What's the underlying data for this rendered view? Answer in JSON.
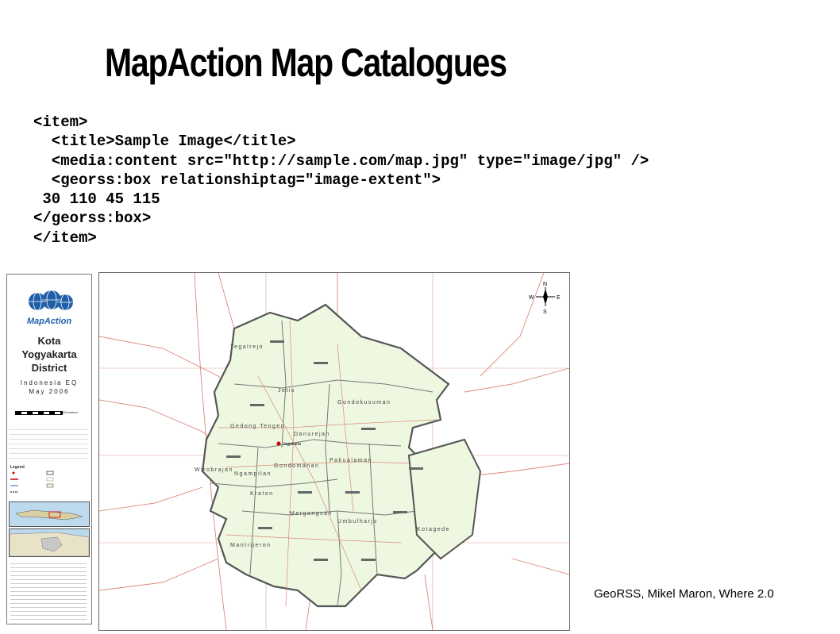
{
  "slide": {
    "title": "MapAction Map Catalogues",
    "code_lines": [
      "<item>",
      "  <title>Sample Image</title>",
      "  <media:content src=\"http://sample.com/map.jpg\" type=\"image/jpg\" />",
      "  <georss:box relationshiptag=\"image-extent\">",
      " 30 110 45 115",
      "</georss:box>",
      "</item>"
    ],
    "footer": "GeoRSS, Mikel Maron, Where 2.0"
  },
  "map": {
    "logo": "MapAction",
    "title_lines": [
      "Kota",
      "Yogyakarta",
      "District"
    ],
    "subtitle": [
      "Indonesia EQ",
      "May 2006"
    ],
    "scale_label": "Kilometers",
    "legend_title": "Legend",
    "city_label": "Jogjakarta",
    "districts": [
      "Tegalrejo",
      "Jetis",
      "Gondokusuman",
      "Gedong Tengen",
      "Danurejan",
      "Wirobrajan",
      "Ngampilan",
      "Gondomanan",
      "Pakualaman",
      "Kraton",
      "Mergangsan",
      "Umbulharjo",
      "Kotagede",
      "Mantrijeron"
    ],
    "compass": [
      "N",
      "S",
      "E",
      "W"
    ],
    "colors": {
      "district_fill": "#eef8e0",
      "boundary": "#555555",
      "road": "#d98a7a",
      "grid": "#d98a7a"
    }
  }
}
